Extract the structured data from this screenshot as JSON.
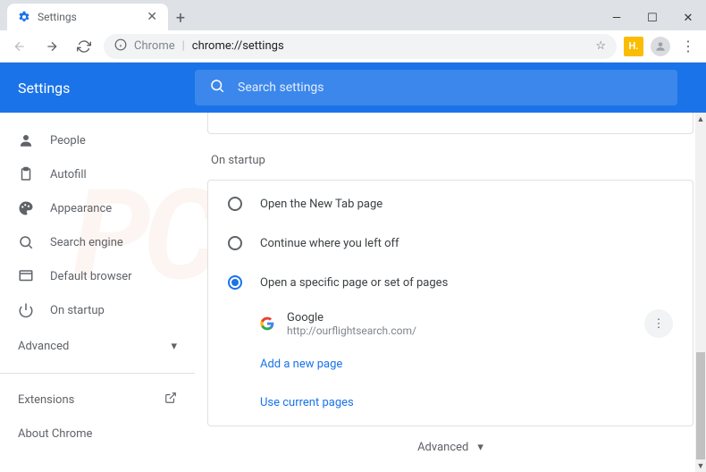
{
  "window": {
    "tab_title": "Settings",
    "min": "—",
    "max": "☐",
    "close": "✕"
  },
  "addrbar": {
    "scheme_label": "Chrome",
    "url": "chrome://settings",
    "ext_badge": "H."
  },
  "header": {
    "title": "Settings",
    "search_placeholder": "Search settings"
  },
  "sidebar": {
    "items": [
      {
        "icon": "person",
        "label": "People"
      },
      {
        "icon": "clipboard",
        "label": "Autofill"
      },
      {
        "icon": "palette",
        "label": "Appearance"
      },
      {
        "icon": "search",
        "label": "Search engine"
      },
      {
        "icon": "browser",
        "label": "Default browser"
      },
      {
        "icon": "power",
        "label": "On startup"
      }
    ],
    "advanced": "Advanced",
    "extensions": "Extensions",
    "about": "About Chrome"
  },
  "content": {
    "section": "On startup",
    "options": [
      {
        "label": "Open the New Tab page",
        "checked": false
      },
      {
        "label": "Continue where you left off",
        "checked": false
      },
      {
        "label": "Open a specific page or set of pages",
        "checked": true
      }
    ],
    "page_entry": {
      "title": "Google",
      "url": "http://ourflightsearch.com/"
    },
    "add_link": "Add a new page",
    "use_link": "Use current pages",
    "advanced_footer": "Advanced"
  },
  "watermark": "PCrisk.com"
}
